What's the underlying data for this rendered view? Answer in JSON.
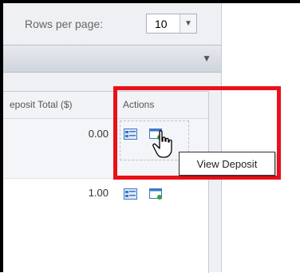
{
  "pagination": {
    "rows_per_page_label": "Rows per page:",
    "rows_per_page_value": "10"
  },
  "table": {
    "columns": [
      "eposit Total ($)",
      "Actions"
    ],
    "rows": [
      {
        "deposit_total": "0.00",
        "actions": [
          "deposit-details-icon",
          "view-deposit-icon"
        ]
      },
      {
        "deposit_total": "1.00",
        "actions": [
          "deposit-details-icon",
          "view-deposit-icon"
        ]
      }
    ]
  },
  "tooltip": {
    "text": "View Deposit"
  },
  "icons": {
    "filter_toggle": "triangle-down-icon",
    "select_arrow": "chevron-down-icon",
    "pointer": "hand-pointer-cursor"
  },
  "colors": {
    "highlight": "#e8111a",
    "icon_blue": "#3a78c9",
    "icon_green": "#3b9e3b"
  }
}
